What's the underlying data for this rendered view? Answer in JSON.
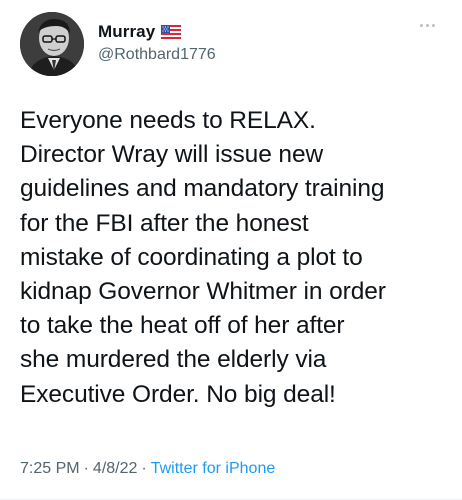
{
  "tweet": {
    "author": {
      "display_name": "Murray",
      "flag": "us-flag-icon",
      "handle": "@Rothbard1776"
    },
    "menu_icon": "more-horizontal-icon",
    "text": "Everyone needs to RELAX.\nDirector Wray will issue new\nguidelines and mandatory training\nfor the FBI after the honest\nmistake of coordinating a plot to\nkidnap Governor Whitmer in order\nto take the heat off of her after\nshe murdered the elderly via\nExecutive Order. No big deal!",
    "time": "7:25 PM",
    "separator": "·",
    "date": "4/8/22",
    "source": "Twitter for iPhone"
  },
  "colors": {
    "text": "#0f1419",
    "secondary": "#536471",
    "link": "#1d9bf0"
  }
}
